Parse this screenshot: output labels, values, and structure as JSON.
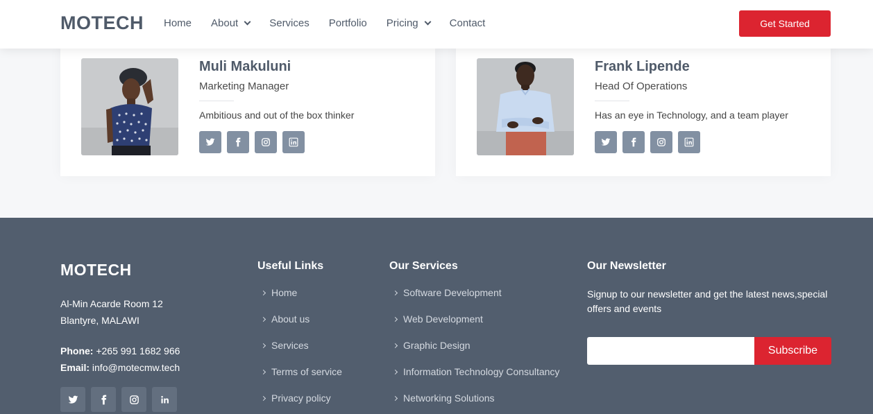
{
  "header": {
    "logo": "MOTECH",
    "nav": [
      {
        "label": "Home",
        "dropdown": false
      },
      {
        "label": "About",
        "dropdown": true
      },
      {
        "label": "Services",
        "dropdown": false
      },
      {
        "label": "Portfolio",
        "dropdown": false
      },
      {
        "label": "Pricing",
        "dropdown": true
      },
      {
        "label": "Contact",
        "dropdown": false
      }
    ],
    "cta_label": "Get Started"
  },
  "team": [
    {
      "name": "Muli Makuluni",
      "role": "Marketing Manager",
      "description": "Ambitious and out of the box thinker",
      "socials": [
        "twitter-icon",
        "facebook-icon",
        "instagram-icon",
        "linkedin-icon"
      ]
    },
    {
      "name": "Frank Lipende",
      "role": "Head Of Operations",
      "description": "Has an eye in Technology, and a team player",
      "socials": [
        "twitter-icon",
        "facebook-icon",
        "instagram-icon",
        "linkedin-icon"
      ]
    }
  ],
  "footer": {
    "logo": "MOTECH",
    "address_line1": "Al-Min Acarde Room 12",
    "address_line2": "Blantyre, MALAWI",
    "phone_label": "Phone:",
    "phone": "+265 991 1682 966",
    "email_label": "Email:",
    "email": "info@motecmw.tech",
    "socials": [
      "twitter-icon",
      "facebook-icon",
      "instagram-icon",
      "linkedin-icon"
    ],
    "useful_links": {
      "title": "Useful Links",
      "items": [
        "Home",
        "About us",
        "Services",
        "Terms of service",
        "Privacy policy"
      ]
    },
    "services": {
      "title": "Our Services",
      "items": [
        "Software Development",
        "Web Development",
        "Graphic Design",
        "Information Technology Consultancy",
        "Networking Solutions"
      ]
    },
    "newsletter": {
      "title": "Our Newsletter",
      "text": "Signup to our newsletter and get the latest news,special offers and events",
      "input_value": "",
      "button_label": "Subscribe"
    }
  },
  "colors": {
    "accent": "#dc2430",
    "text_dark": "#4f5a69",
    "footer_bg": "#525e6e",
    "social_bg": "#8290a2"
  }
}
